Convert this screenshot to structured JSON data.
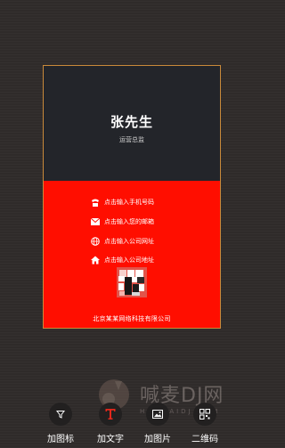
{
  "card": {
    "name": "张先生",
    "title": "运营总监",
    "phone": "点击输入手机号码",
    "email": "点击输入您的邮箱",
    "website": "点击输入公司网址",
    "address": "点击输入公司地址",
    "company": "北京某某网络科技有限公司"
  },
  "toolbar": {
    "add_icon_label": "加图标",
    "add_text_label": "加文字",
    "add_image_label": "加图片",
    "qr_code_label": "二维码"
  },
  "watermark": {
    "text": "喊麦DJ网",
    "sub": "HANMAIDJ.COM"
  },
  "icons": [
    "phone-icon",
    "email-icon",
    "globe-icon",
    "home-icon",
    "funnel-icon",
    "text-icon",
    "image-icon",
    "qr-code-icon"
  ],
  "colors": {
    "card_top": "#23252a",
    "card_bottom": "#ff0e00",
    "card_border": "#c98a3a",
    "background": "#2f2b2a"
  }
}
